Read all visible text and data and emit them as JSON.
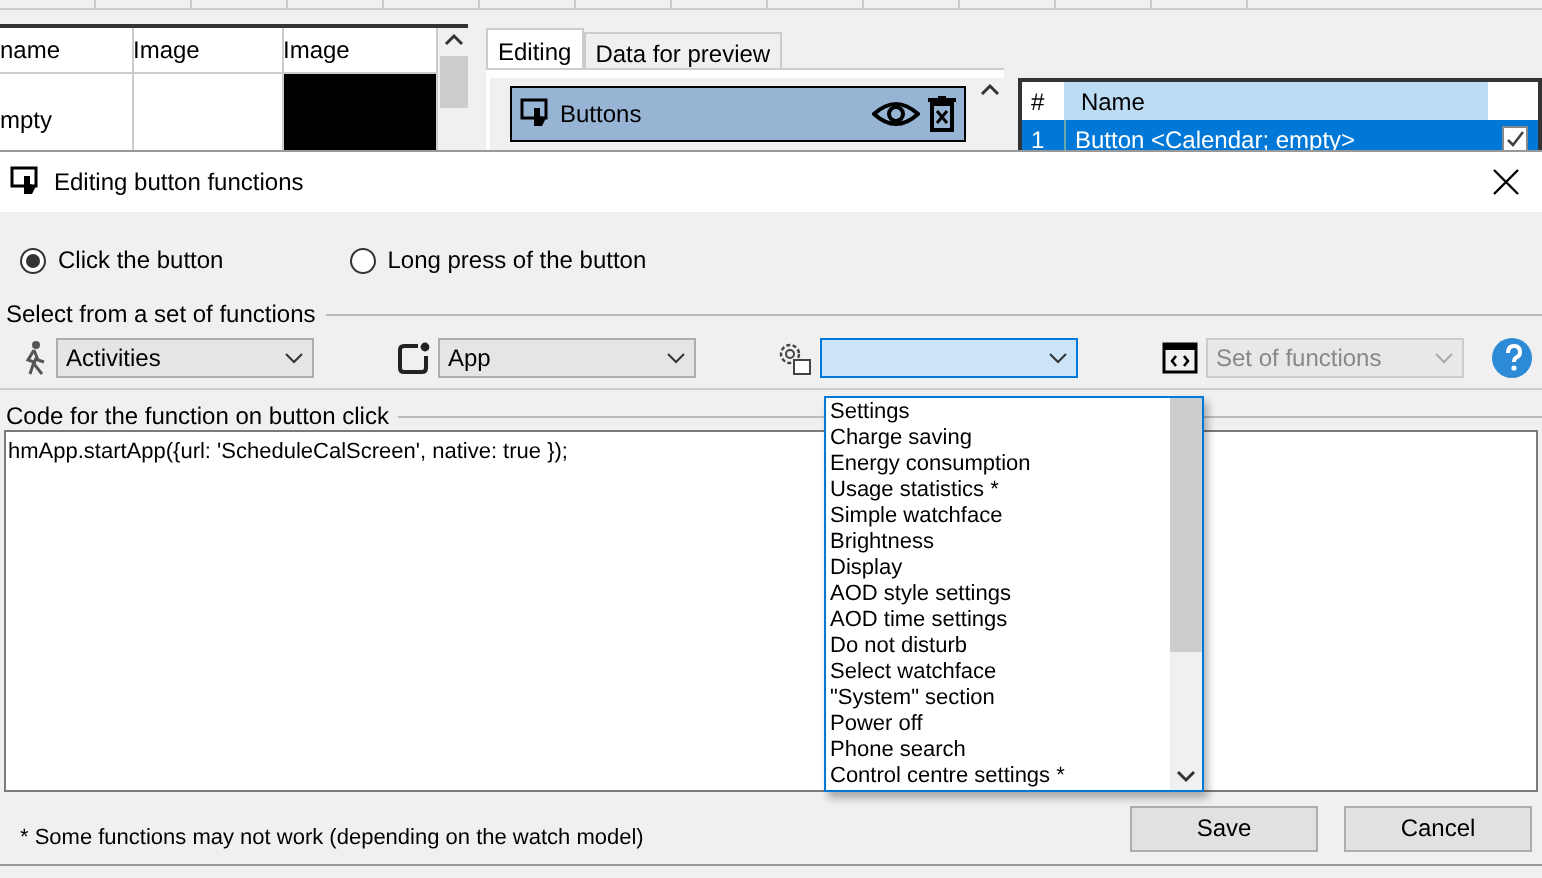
{
  "background": {
    "left_table": {
      "columns": [
        "name",
        "Image",
        "Image"
      ],
      "rows": [
        {
          "cells": [
            "mpty",
            "",
            ""
          ],
          "kind": "image-row"
        }
      ]
    },
    "tabs": [
      {
        "label": "Editing",
        "selected": true
      },
      {
        "label": "Data for preview",
        "selected": false
      }
    ],
    "elements": [
      {
        "label": "Buttons",
        "selected": true
      }
    ],
    "buttons_table": {
      "columns": [
        "#",
        "Name"
      ],
      "rows": [
        {
          "number": "1",
          "name": "Button <Calendar; empty>",
          "selected": true,
          "checked": true
        }
      ]
    }
  },
  "dialog": {
    "title": "Editing button functions",
    "press_modes": [
      {
        "label": "Click the button",
        "selected": true
      },
      {
        "label": "Long press of the button",
        "selected": false
      }
    ],
    "function_group": {
      "title": "Select from a set of functions",
      "selectors": [
        {
          "kind": "activity",
          "value": "Activities",
          "focused": false,
          "disabled": false
        },
        {
          "kind": "app",
          "value": "App",
          "focused": false,
          "disabled": false
        },
        {
          "kind": "system",
          "focused": true,
          "disabled": false
        },
        {
          "kind": "code",
          "value": "Set of functions",
          "focused": false,
          "disabled": true
        }
      ]
    },
    "dropdown": {
      "items": [
        "Settings",
        "Charge saving",
        "Energy consumption",
        "Usage statistics *",
        "Simple watchface",
        "Brightness",
        "Display",
        "AOD style settings",
        "AOD time settings",
        "Do not disturb",
        "Select watchface",
        "\"System\" section",
        "Power off",
        "Phone search",
        "Control centre settings *"
      ]
    },
    "code_group": {
      "title": "Code for the function on button click",
      "code": "hmApp.startApp({url: 'ScheduleCalScreen', native: true });"
    },
    "footnote": "* Some functions may not work (depending on the watch model)",
    "buttons": [
      "Save",
      "Cancel"
    ]
  }
}
